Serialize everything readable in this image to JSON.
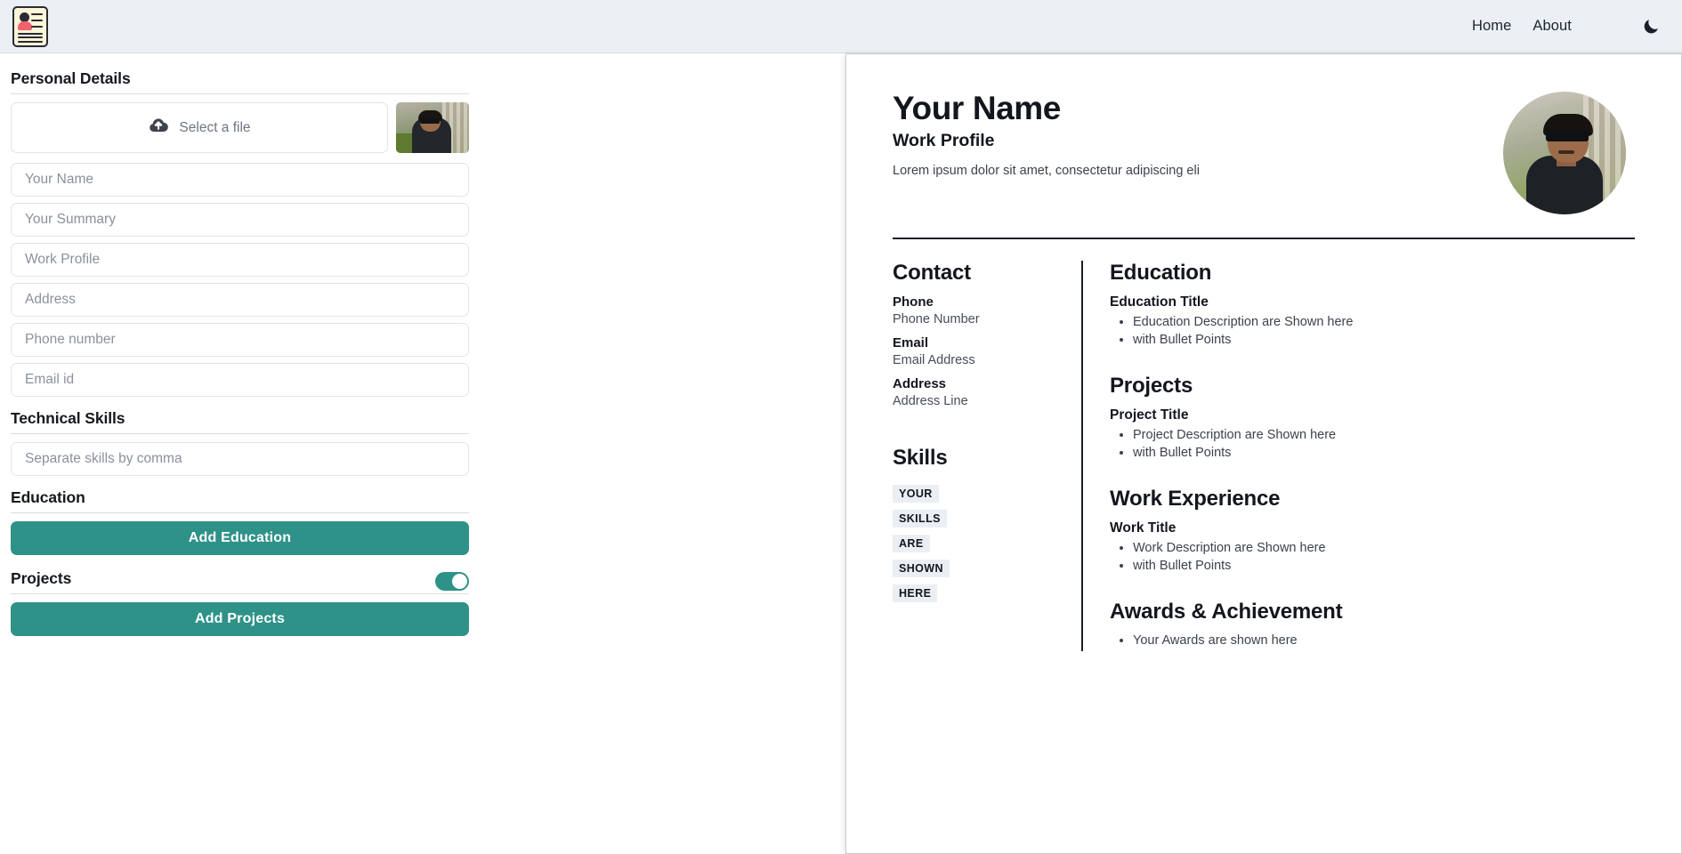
{
  "navbar": {
    "logo_icon": "resume-document-icon",
    "links": [
      {
        "label": "Home"
      },
      {
        "label": "About"
      }
    ],
    "theme_toggle_icon": "moon-icon"
  },
  "form": {
    "personal_details": {
      "title": "Personal Details",
      "upload": {
        "label": "Select a file",
        "icon": "cloud-upload-icon",
        "thumbnail_alt": "uploaded-profile-photo"
      },
      "fields": [
        {
          "placeholder": "Your Name",
          "value": ""
        },
        {
          "placeholder": "Your Summary",
          "value": ""
        },
        {
          "placeholder": "Work Profile",
          "value": ""
        },
        {
          "placeholder": "Address",
          "value": ""
        },
        {
          "placeholder": "Phone number",
          "value": ""
        },
        {
          "placeholder": "Email id",
          "value": ""
        }
      ]
    },
    "technical_skills": {
      "title": "Technical Skills",
      "placeholder": "Separate skills by comma",
      "value": ""
    },
    "education": {
      "title": "Education",
      "add_button": "Add Education"
    },
    "projects": {
      "title": "Projects",
      "add_button": "Add Projects",
      "toggle_on": true
    }
  },
  "resume": {
    "name": "Your Name",
    "role": "Work Profile",
    "summary": "Lorem ipsum dolor sit amet, consectetur adipiscing eli",
    "photo_alt": "profile-photo",
    "contact": {
      "title": "Contact",
      "entries": [
        {
          "label": "Phone",
          "value": "Phone Number"
        },
        {
          "label": "Email",
          "value": "Email Address"
        },
        {
          "label": "Address",
          "value": "Address Line"
        }
      ]
    },
    "skills": {
      "title": "Skills",
      "chips": [
        "YOUR",
        "SKILLS",
        "ARE",
        "SHOWN",
        "HERE"
      ]
    },
    "sections": [
      {
        "title": "Education",
        "item_title": "Education Title",
        "bullets": [
          "Education Description are Shown here",
          "with Bullet Points"
        ]
      },
      {
        "title": "Projects",
        "item_title": "Project Title",
        "bullets": [
          "Project Description are Shown here",
          "with Bullet Points"
        ]
      },
      {
        "title": "Work Experience",
        "item_title": "Work Title",
        "bullets": [
          "Work Description are Shown here",
          "with Bullet Points"
        ]
      },
      {
        "title": "Awards & Achievement",
        "item_title": "",
        "bullets": [
          "Your Awards are shown here"
        ]
      }
    ]
  },
  "colors": {
    "accent": "#2f9289",
    "navbar_bg": "#eaf0f4",
    "chip_bg": "#eaeff4",
    "text": "#13161d"
  }
}
